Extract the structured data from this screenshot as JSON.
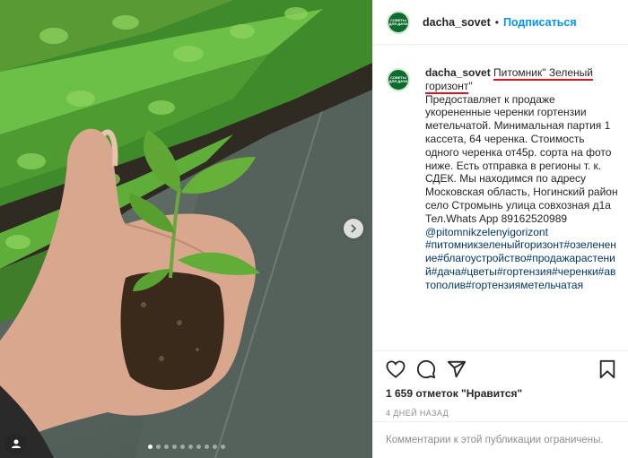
{
  "post": {
    "username": "dacha_sovet",
    "separator": "•",
    "follow_label": "Подписаться",
    "avatar_text": "СОВЕТЫ ДЛЯ ДАЧИ",
    "caption": {
      "title_part1": "Питомник\" Зеленый",
      "title_part2": "горизонт",
      "title_end": "\"",
      "text": "Предоставляет к продаже укорененные черенки гортензии метельчатой. Минимальная партия 1 кассета, 64 черенка. Стоимость одного черенка от45р. сорта на фото ниже. Есть отправка в регионы т. к. СДЕК. Мы находимся по адресу Московская область, Ногинский район село Стромынь улица совхозная д1а",
      "phone": "Тел.Whats App 89162520989",
      "mention": "@pitomnikzelenyigorizont",
      "hashtags": "#питомникзеленыйгоризонт#озеленение#благоустройство#продажарастений#дача#цветы#гортензия#черенки#автополив#гортензияметельчатая"
    },
    "likes_text": "1 659 отметок \"Нравится\"",
    "date_text": "4 ДНЕЙ НАЗАД",
    "comments_disabled_text": "Комментарии к этой публикации ограничены."
  },
  "carousel": {
    "dots": 10,
    "active_index": 0
  },
  "icons": [
    "heart-icon",
    "comment-icon",
    "share-icon",
    "bookmark-icon",
    "chevron-right-icon",
    "user-tag-icon"
  ],
  "colors": {
    "link": "#0095f6",
    "hashtag": "#00376b",
    "underline": "#e0141f",
    "muted": "#8e8e8e"
  }
}
